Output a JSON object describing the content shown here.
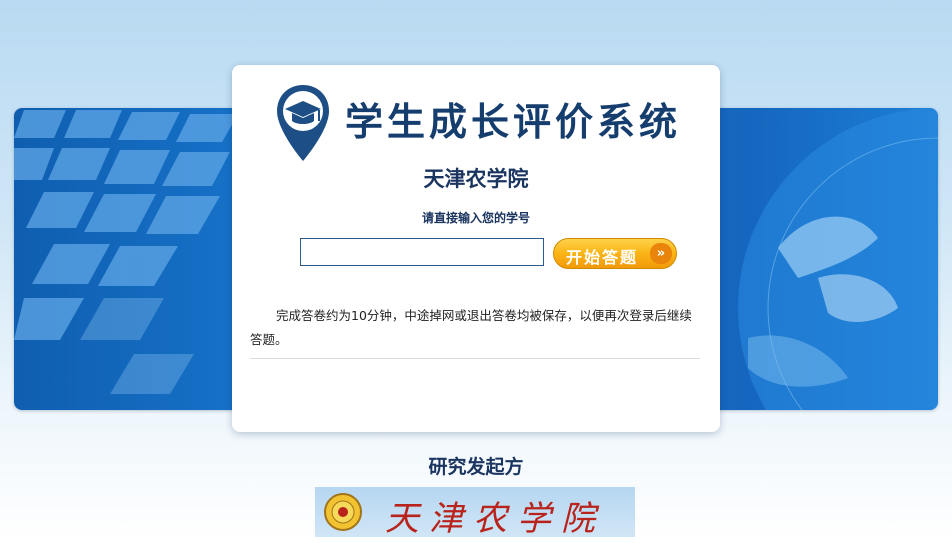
{
  "header": {
    "system_title": "学生成长评价系统",
    "school_name": "天津农学院"
  },
  "form": {
    "prompt": "请直接输入您的学号",
    "id_value": "",
    "start_button_label": "开始答题",
    "start_button_arrow": "»"
  },
  "notice": "完成答卷约为10分钟，中途掉网或退出答卷均被保存，以便再次登录后继续答题。",
  "sponsor": {
    "title": "研究发起方",
    "logo_text": "天津农学院"
  },
  "colors": {
    "brand_blue": "#153d6e",
    "accent_orange": "#fbb416",
    "banner_blue": "#1876cd"
  }
}
